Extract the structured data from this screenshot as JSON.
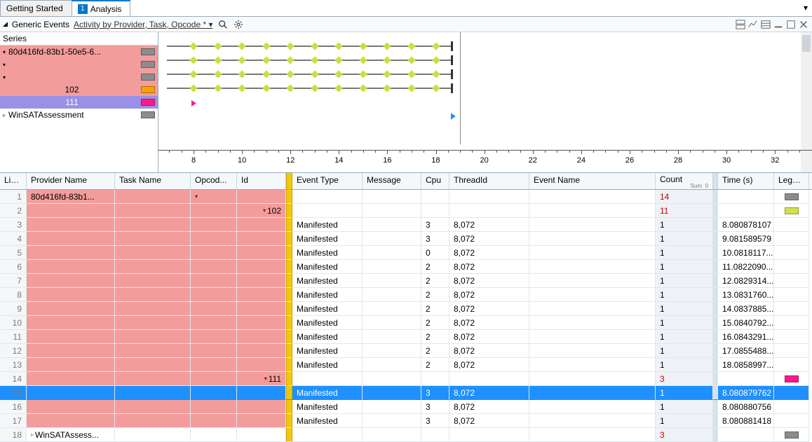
{
  "tabs": {
    "gettingStarted": "Getting Started",
    "analysis": "Analysis",
    "badge": "1"
  },
  "subbar": {
    "label": "Generic Events",
    "crumb": "Activity by Provider, Task, Opcode *"
  },
  "series": {
    "title": "Series",
    "rows": [
      {
        "txt": "80d416fd-83b1-50e5-6...",
        "sw": "#8c8c8c",
        "cls": "red",
        "tri": "▾"
      },
      {
        "txt": "",
        "sw": "#8c8c8c",
        "cls": "red",
        "tri": "▾"
      },
      {
        "txt": "",
        "sw": "#8c8c8c",
        "cls": "red",
        "tri": "▾"
      },
      {
        "txt": "102",
        "sw": "#f5a20a",
        "cls": "orange",
        "tri": "",
        "center": true
      },
      {
        "txt": "111",
        "sw": "#ff1a8c",
        "cls": "purple",
        "tri": "",
        "center": true
      },
      {
        "txt": "WinSATAssessment",
        "sw": "#8c8c8c",
        "cls": "",
        "tri": "▹"
      }
    ]
  },
  "axis": {
    "labels": [
      "8",
      "10",
      "12",
      "14",
      "16",
      "18",
      "20",
      "22",
      "24",
      "26",
      "28",
      "30",
      "32"
    ]
  },
  "columns": {
    "line": "Lin...",
    "prov": "Provider Name",
    "task": "Task Name",
    "op": "Opcod...",
    "id": "Id",
    "etype": "Event Type",
    "msg": "Message",
    "cpu": "Cpu",
    "tid": "ThreadId",
    "ename": "Event Name",
    "count": "Count",
    "countSub": "0\nSum",
    "time": "Time (s)",
    "legend": "Legend"
  },
  "rows": [
    {
      "n": "1",
      "prov": "80d416fd-83b1...",
      "opTri": true,
      "count": "14",
      "lsw": "#8c8c8c"
    },
    {
      "n": "2",
      "idTri": true,
      "id": "102",
      "count": "11",
      "lsw": "#d2e048"
    },
    {
      "n": "3",
      "etype": "Manifested",
      "cpu": "3",
      "tid": "8,072",
      "count": "1",
      "time": "8.080878107"
    },
    {
      "n": "4",
      "etype": "Manifested",
      "cpu": "3",
      "tid": "8,072",
      "count": "1",
      "time": "9.081589579"
    },
    {
      "n": "5",
      "etype": "Manifested",
      "cpu": "0",
      "tid": "8,072",
      "count": "1",
      "time": "10.0818117..."
    },
    {
      "n": "6",
      "etype": "Manifested",
      "cpu": "2",
      "tid": "8,072",
      "count": "1",
      "time": "11.0822090..."
    },
    {
      "n": "7",
      "etype": "Manifested",
      "cpu": "2",
      "tid": "8,072",
      "count": "1",
      "time": "12.0829314..."
    },
    {
      "n": "8",
      "etype": "Manifested",
      "cpu": "2",
      "tid": "8,072",
      "count": "1",
      "time": "13.0831760..."
    },
    {
      "n": "9",
      "etype": "Manifested",
      "cpu": "2",
      "tid": "8,072",
      "count": "1",
      "time": "14.0837885..."
    },
    {
      "n": "10",
      "etype": "Manifested",
      "cpu": "2",
      "tid": "8,072",
      "count": "1",
      "time": "15.0840792..."
    },
    {
      "n": "11",
      "etype": "Manifested",
      "cpu": "2",
      "tid": "8,072",
      "count": "1",
      "time": "16.0843291..."
    },
    {
      "n": "12",
      "etype": "Manifested",
      "cpu": "2",
      "tid": "8,072",
      "count": "1",
      "time": "17.0855488..."
    },
    {
      "n": "13",
      "etype": "Manifested",
      "cpu": "2",
      "tid": "8,072",
      "count": "1",
      "time": "18.0858997..."
    },
    {
      "n": "14",
      "idTri": true,
      "id": "111",
      "count": "3",
      "lsw": "#ff1a8c"
    },
    {
      "n": "15",
      "etype": "Manifested",
      "cpu": "3",
      "tid": "8,072",
      "count": "1",
      "time": "8.080879762",
      "selected": true
    },
    {
      "n": "16",
      "etype": "Manifested",
      "cpu": "3",
      "tid": "8,072",
      "count": "1",
      "time": "8.080880756"
    },
    {
      "n": "17",
      "etype": "Manifested",
      "cpu": "3",
      "tid": "8,072",
      "count": "1",
      "time": "8.080881418"
    },
    {
      "n": "18",
      "prov": "WinSATAssess...",
      "provTri": true,
      "count": "3",
      "white": true,
      "lsw": "#8c8c8c"
    }
  ]
}
